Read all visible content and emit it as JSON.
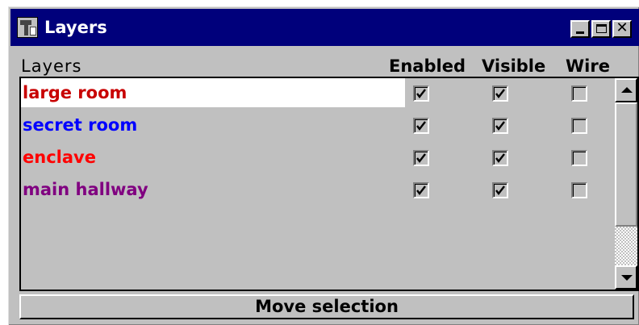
{
  "window": {
    "title": "Layers",
    "controls": {
      "minimize": "minimize-icon",
      "maximize": "maximize-icon",
      "close": "close-icon",
      "close_glyph": "✕"
    }
  },
  "headers": {
    "layers": "Layers",
    "enabled": "Enabled",
    "visible": "Visible",
    "wire": "Wire"
  },
  "layers": [
    {
      "name": "large room",
      "color": "#c80000",
      "enabled": true,
      "visible": true,
      "wire": false,
      "selected": true
    },
    {
      "name": "secret room",
      "color": "#0000ff",
      "enabled": true,
      "visible": true,
      "wire": false,
      "selected": false
    },
    {
      "name": "enclave",
      "color": "#ff0000",
      "enabled": true,
      "visible": true,
      "wire": false,
      "selected": false
    },
    {
      "name": "main hallway",
      "color": "#800080",
      "enabled": true,
      "visible": true,
      "wire": false,
      "selected": false
    }
  ],
  "footer": {
    "move_label": "Move selection"
  }
}
